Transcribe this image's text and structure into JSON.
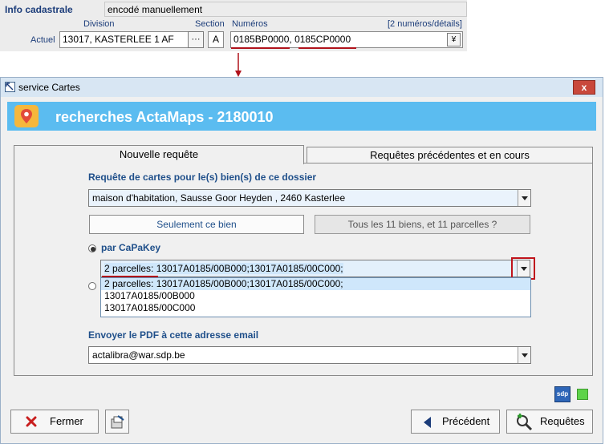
{
  "info_panel": {
    "title": "Info cadastrale",
    "mode_value": "encodé manuellement",
    "col_division": "Division",
    "col_section": "Section",
    "col_numeros": "Numéros",
    "details_link": "[2 numéros/détails]",
    "row_label": "Actuel",
    "division_value": "13017, KASTERLEE  1 AF",
    "division_btn": "···",
    "section_value": "A",
    "numero_1": "0185BP0000",
    "numero_sep": ", ",
    "numero_2": "0185CP0000",
    "expand_btn": "¥"
  },
  "window": {
    "title": "service Cartes",
    "close_label": "x",
    "header_title": "recherches ActaMaps - 2180010"
  },
  "tabs": [
    {
      "label": "Nouvelle requête",
      "active": true
    },
    {
      "label": "Requêtes précédentes et en cours",
      "active": false
    }
  ],
  "form": {
    "request_label": "Requête de cartes pour le(s) bien(s) de ce dossier",
    "property_value": "maison d'habitation, Sausse Goor Heyden , 2460 Kasterlee",
    "btn_single": "Seulement ce bien",
    "btn_all": "Tous les 11 biens, et 11 parcelles ?",
    "capakey_label": "par CaPaKey",
    "capakey_value": "2 parcelles: 13017A0185/00B000;13017A0185/00C000;",
    "dropdown_options": [
      "2 parcelles: 13017A0185/00B000;13017A0185/00C000;",
      "13017A0185/00B000",
      "13017A0185/00C000"
    ],
    "email_label": "Envoyer le PDF à cette adresse email",
    "email_value": "actalibra@war.sdp.be"
  },
  "status": {
    "logo_text": "sdp",
    "indicator_color": "#5ed34a"
  },
  "buttons": {
    "close": "Fermer",
    "previous": "Précédent",
    "requests": "Requêtes"
  },
  "colors": {
    "header_band": "#5bbcf0",
    "label_blue": "#1f4f8a",
    "highlight_red": "#b0121b"
  }
}
